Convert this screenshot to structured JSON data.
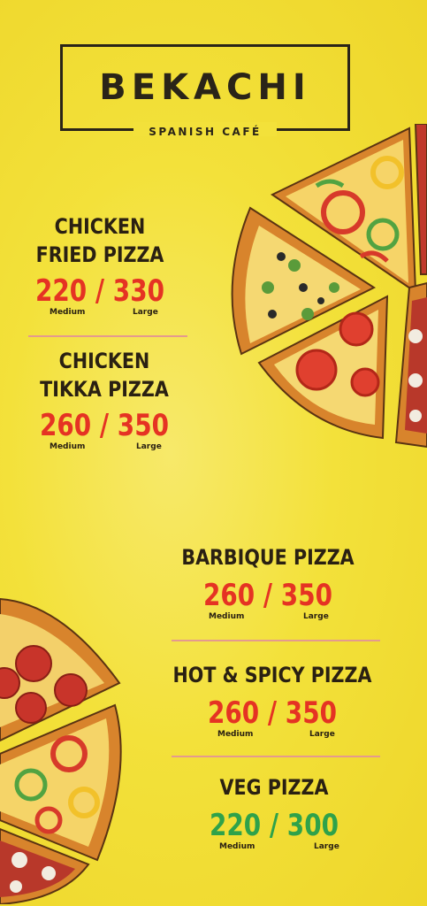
{
  "brand": {
    "name": "BEKACHI",
    "tagline": "SPANISH CAFÉ"
  },
  "menu": [
    {
      "name_lines": [
        "CHICKEN",
        "FRIED PIZZA"
      ],
      "price_medium": "220",
      "price_large": "330",
      "separator": "/",
      "label_medium": "Medium",
      "label_large": "Large",
      "price_color": "#e53323"
    },
    {
      "name_lines": [
        "CHICKEN",
        "TIKKA PIZZA"
      ],
      "price_medium": "260",
      "price_large": "350",
      "separator": "/",
      "label_medium": "Medium",
      "label_large": "Large",
      "price_color": "#e53323"
    },
    {
      "name_lines": [
        "BARBIQUE PIZZA"
      ],
      "price_medium": "260",
      "price_large": "350",
      "separator": "/",
      "label_medium": "Medium",
      "label_large": "Large",
      "price_color": "#e53323"
    },
    {
      "name_lines": [
        "HOT & SPICY PIZZA"
      ],
      "price_medium": "260",
      "price_large": "350",
      "separator": "/",
      "label_medium": "Medium",
      "label_large": "Large",
      "price_color": "#e53323"
    },
    {
      "name_lines": [
        "VEG PIZZA"
      ],
      "price_medium": "220",
      "price_large": "300",
      "separator": "/",
      "label_medium": "Medium",
      "label_large": "Large",
      "price_color": "#2fa24a"
    }
  ],
  "colors": {
    "background": "#f3e13a",
    "text": "#2a2012",
    "price_red": "#e53323",
    "price_green": "#2fa24a",
    "divider": "#e49a8e"
  }
}
